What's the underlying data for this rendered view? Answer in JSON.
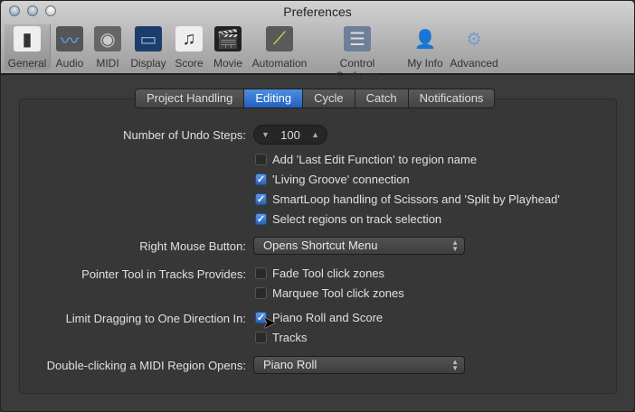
{
  "window": {
    "title": "Preferences"
  },
  "toolbar": [
    {
      "label": "General",
      "icon": "general-switch-icon"
    },
    {
      "label": "Audio",
      "icon": "audio-waveform-icon"
    },
    {
      "label": "MIDI",
      "icon": "midi-connector-icon"
    },
    {
      "label": "Display",
      "icon": "display-monitor-icon"
    },
    {
      "label": "Score",
      "icon": "score-notes-icon"
    },
    {
      "label": "Movie",
      "icon": "movie-clapper-icon"
    },
    {
      "label": "Automation",
      "icon": "automation-curve-icon"
    },
    {
      "label": "Control Surfaces",
      "icon": "control-surfaces-faders-icon"
    },
    {
      "label": "My Info",
      "icon": "my-info-person-icon"
    },
    {
      "label": "Advanced",
      "icon": "advanced-gear-icon"
    }
  ],
  "tabs": [
    "Project Handling",
    "Editing",
    "Cycle",
    "Catch",
    "Notifications"
  ],
  "active_tab": "Editing",
  "undo": {
    "label": "Number of Undo Steps:",
    "value": "100"
  },
  "options": [
    {
      "label": "Add 'Last Edit Function' to region name",
      "checked": false
    },
    {
      "label": "'Living Groove' connection",
      "checked": true
    },
    {
      "label": "SmartLoop handling of Scissors and 'Split by Playhead'",
      "checked": true
    },
    {
      "label": "Select regions on track selection",
      "checked": true
    }
  ],
  "right_mouse": {
    "label": "Right Mouse Button:",
    "value": "Opens Shortcut Menu"
  },
  "pointer_tool": {
    "label": "Pointer Tool in Tracks Provides:",
    "options": [
      {
        "label": "Fade Tool click zones",
        "checked": false
      },
      {
        "label": "Marquee Tool click zones",
        "checked": false
      }
    ]
  },
  "limit_drag": {
    "label": "Limit Dragging to One Direction In:",
    "options": [
      {
        "label": "Piano Roll and Score",
        "checked": true
      },
      {
        "label": "Tracks",
        "checked": false
      }
    ]
  },
  "double_click": {
    "label": "Double-clicking a MIDI Region Opens:",
    "value": "Piano Roll"
  },
  "colors": {
    "accent": "#2f6fd0",
    "background": "#3b3b3b"
  }
}
